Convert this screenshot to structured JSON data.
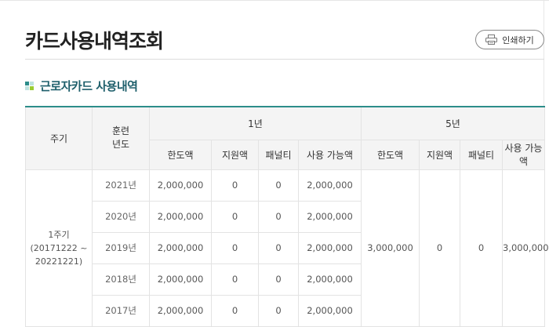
{
  "page": {
    "title": "카드사용내역조회"
  },
  "toolbar": {
    "print_label": "인쇄하기",
    "print_icon": "printer-icon"
  },
  "section": {
    "title": "근로자카드 사용내역",
    "icon": "section-square-icon",
    "accent_color": "#2c8d8a",
    "title_color": "#1e5f6b"
  },
  "table": {
    "headers": {
      "period": "주기",
      "train_year": "훈련 년도",
      "group_1y": "1년",
      "group_5y": "5년",
      "limit": "한도액",
      "support": "지원액",
      "penalty": "패널티",
      "available": "사용 가능액"
    },
    "period": {
      "name": "1주기",
      "range": "(20171222 ~ 20221221)"
    },
    "rows": [
      {
        "year": "2021년",
        "limit": "2,000,000",
        "support": "0",
        "penalty": "0",
        "available": "2,000,000"
      },
      {
        "year": "2020년",
        "limit": "2,000,000",
        "support": "0",
        "penalty": "0",
        "available": "2,000,000"
      },
      {
        "year": "2019년",
        "limit": "2,000,000",
        "support": "0",
        "penalty": "0",
        "available": "2,000,000"
      },
      {
        "year": "2018년",
        "limit": "2,000,000",
        "support": "0",
        "penalty": "0",
        "available": "2,000,000"
      },
      {
        "year": "2017년",
        "limit": "2,000,000",
        "support": "0",
        "penalty": "0",
        "available": "2,000,000"
      }
    ],
    "five_year": {
      "limit": "3,000,000",
      "support": "0",
      "penalty": "0",
      "available": "3,000,000"
    }
  }
}
